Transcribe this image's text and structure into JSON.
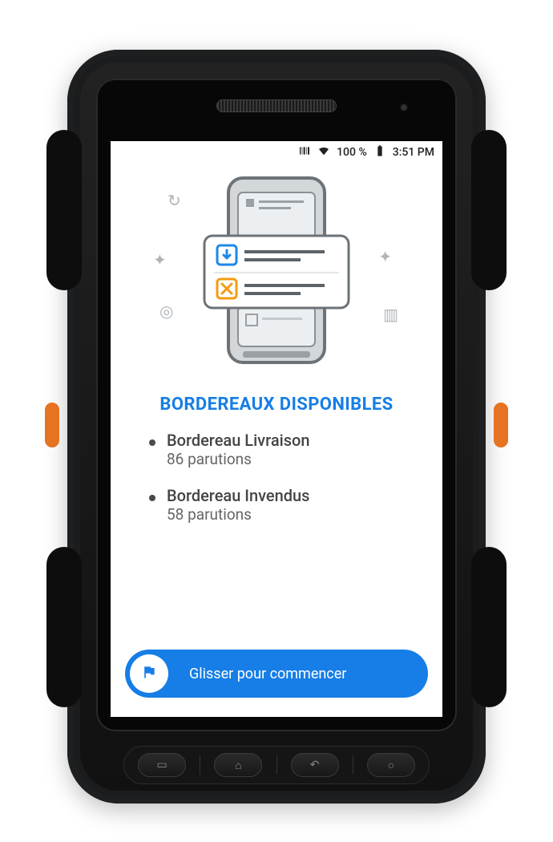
{
  "status": {
    "battery_text": "100 %",
    "time": "3:51 PM"
  },
  "heading": "BORDEREAUX DISPONIBLES",
  "items": [
    {
      "title": "Bordereau Livraison",
      "sub": "86 parutions"
    },
    {
      "title": "Bordereau Invendus",
      "sub": "58 parutions"
    }
  ],
  "slide": {
    "label": "Glisser pour commencer"
  },
  "colors": {
    "accent": "#167ee6",
    "blue_icon": "#1e88e5",
    "orange_icon": "#f39c12"
  }
}
